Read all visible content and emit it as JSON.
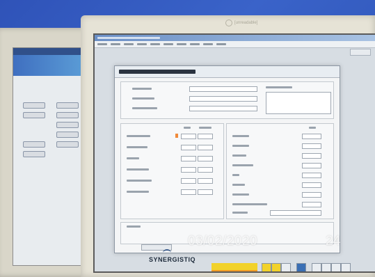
{
  "monitor": {
    "brand_logo": "[unreadable]"
  },
  "window": {
    "title": "[unreadable]",
    "menu": [
      "[unreadable]",
      "[unreadable]",
      "[unreadable]",
      "[unreadable]",
      "[unreadable]",
      "[unreadable]",
      "[unreadable]",
      "[unreadable]",
      "[unreadable]",
      "[unreadable]"
    ],
    "action_label": "[unreadable]"
  },
  "dialog": {
    "title": "[unreadable]",
    "group_top_label": "[unreadable]",
    "fields_left": [
      "[unreadable]",
      "[unreadable]",
      "[unreadable]"
    ],
    "description_label": "[unreadable]",
    "set_header": "[unreadable]",
    "actual_header": "[unreadable]",
    "left_param_labels": [
      "[unreadable]",
      "[unreadable]",
      "[unreadable]",
      "[unreadable]",
      "[unreadable]",
      "[unreadable]"
    ],
    "right_param_labels": [
      "[unreadable]",
      "[unreadable]",
      "[unreadable]",
      "[unreadable]",
      "[unreadable]",
      "[unreadable]",
      "[unreadable]",
      "[unreadable]"
    ],
    "footer_left_label": "[unreadable]",
    "bottom_button_label": "[unreadable]"
  },
  "footer": {
    "brand": "SYNERGISTIQ",
    "yellow_button_label": "[unreadable]",
    "orange_button_label": "[unreadable]"
  },
  "photo_stamp": {
    "date": "03/02/2020",
    "number": "24"
  },
  "colors": {
    "background": "#3a63c9",
    "accent_orange": "#f29a24",
    "accent_yellow": "#f2d22a",
    "brand_text": "#1d2a3a"
  },
  "icons": [
    "brand-logo-icon",
    "tool-icon",
    "lock-icon",
    "camera-icon"
  ]
}
